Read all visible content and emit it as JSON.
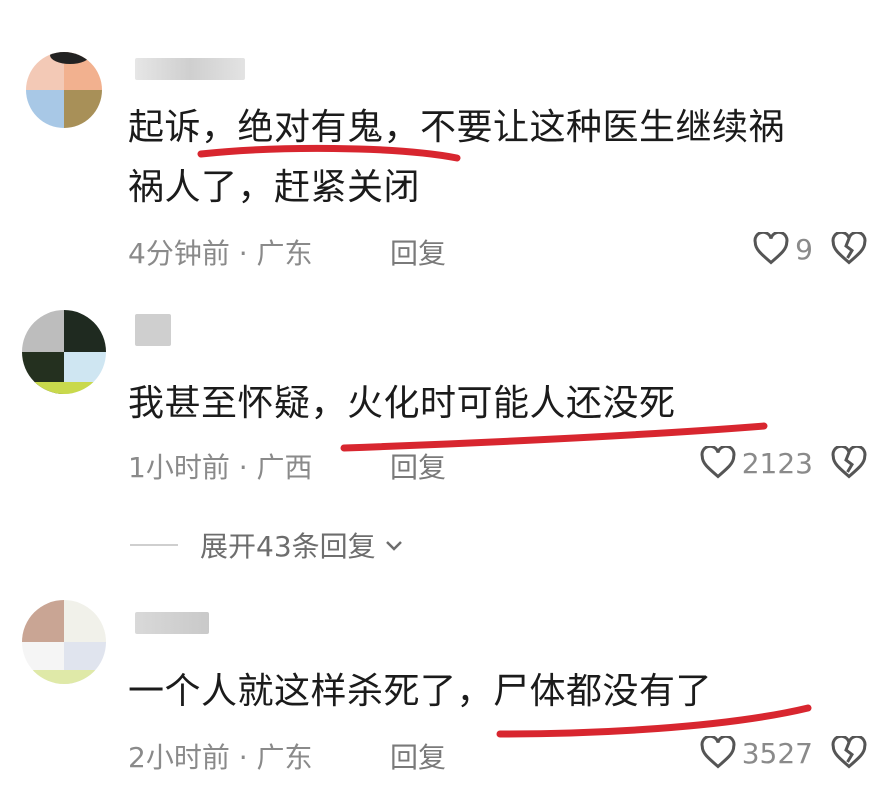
{
  "comments": [
    {
      "text_line1": "起诉，绝对有鬼，不要让这种医生继续祸",
      "text_line2": "祸人了，赶紧关闭",
      "time_location": "4分钟前 · 广东",
      "reply_label": "回复",
      "likes": "9"
    },
    {
      "text_line1": "我甚至怀疑，火化时可能人还没死",
      "time_location": "1小时前 · 广西",
      "reply_label": "回复",
      "likes": "2123"
    },
    {
      "text_line1": "一个人就这样杀死了，尸体都没有了",
      "time_location": "2小时前 · 广东",
      "reply_label": "回复",
      "likes": "3527"
    }
  ],
  "expand_replies_label": "展开43条回复",
  "colors": {
    "underline": "#d8262f",
    "text": "#1b1b1b",
    "meta": "#8a8a8a"
  },
  "icons": [
    "heart-outline-icon",
    "broken-heart-icon",
    "chevron-down-icon"
  ]
}
